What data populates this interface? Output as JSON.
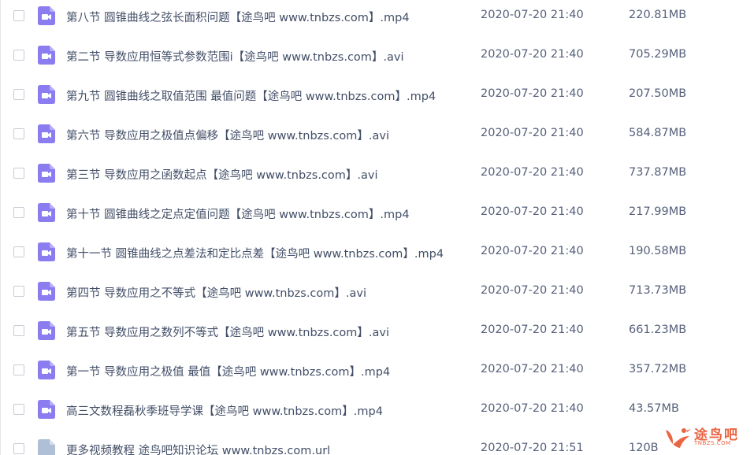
{
  "files": [
    {
      "name": "第八节 圆锥曲线之弦长面积问题【途鸟吧 www.tnbzs.com】.mp4",
      "date": "2020-07-20 21:40",
      "size": "220.81MB",
      "icon": "video-file-icon"
    },
    {
      "name": "第二节 导数应用恒等式参数范围i【途鸟吧 www.tnbzs.com】.avi",
      "date": "2020-07-20 21:40",
      "size": "705.29MB",
      "icon": "video-file-icon"
    },
    {
      "name": "第九节 圆锥曲线之取值范围 最值问题【途鸟吧 www.tnbzs.com】.mp4",
      "date": "2020-07-20 21:40",
      "size": "207.50MB",
      "icon": "video-file-icon"
    },
    {
      "name": "第六节 导数应用之极值点偏移【途鸟吧 www.tnbzs.com】.avi",
      "date": "2020-07-20 21:40",
      "size": "584.87MB",
      "icon": "video-file-icon"
    },
    {
      "name": "第三节 导数应用之函数起点【途鸟吧 www.tnbzs.com】.avi",
      "date": "2020-07-20 21:40",
      "size": "737.87MB",
      "icon": "video-file-icon"
    },
    {
      "name": "第十节 圆锥曲线之定点定值问题【途鸟吧 www.tnbzs.com】.mp4",
      "date": "2020-07-20 21:40",
      "size": "217.99MB",
      "icon": "video-file-icon"
    },
    {
      "name": "第十一节 圆锥曲线之点差法和定比点差【途鸟吧 www.tnbzs.com】.mp4",
      "date": "2020-07-20 21:40",
      "size": "190.58MB",
      "icon": "video-file-icon"
    },
    {
      "name": "第四节 导数应用之不等式【途鸟吧 www.tnbzs.com】.avi",
      "date": "2020-07-20 21:40",
      "size": "713.73MB",
      "icon": "video-file-icon"
    },
    {
      "name": "第五节 导数应用之数列不等式【途鸟吧 www.tnbzs.com】.avi",
      "date": "2020-07-20 21:40",
      "size": "661.23MB",
      "icon": "video-file-icon"
    },
    {
      "name": "第一节 导数应用之极值 最值【途鸟吧 www.tnbzs.com】.mp4",
      "date": "2020-07-20 21:40",
      "size": "357.72MB",
      "icon": "video-file-icon"
    },
    {
      "name": "高三文数程磊秋季班导学课【途鸟吧 www.tnbzs.com】.mp4",
      "date": "2020-07-20 21:40",
      "size": "43.57MB",
      "icon": "video-file-icon"
    },
    {
      "name": "更多视频教程 途鸟吧知识论坛 www.tnbzs.com.url",
      "date": "2020-07-20 21:51",
      "size": "120B",
      "icon": "link-file-icon"
    }
  ],
  "watermark": {
    "title": "途鸟吧",
    "subtitle": "TNBZS.COM"
  },
  "colors": {
    "video_icon": "#8b7cf0",
    "link_icon": "#aebfd6",
    "text": "#424e67",
    "watermark": "#e8552f"
  }
}
